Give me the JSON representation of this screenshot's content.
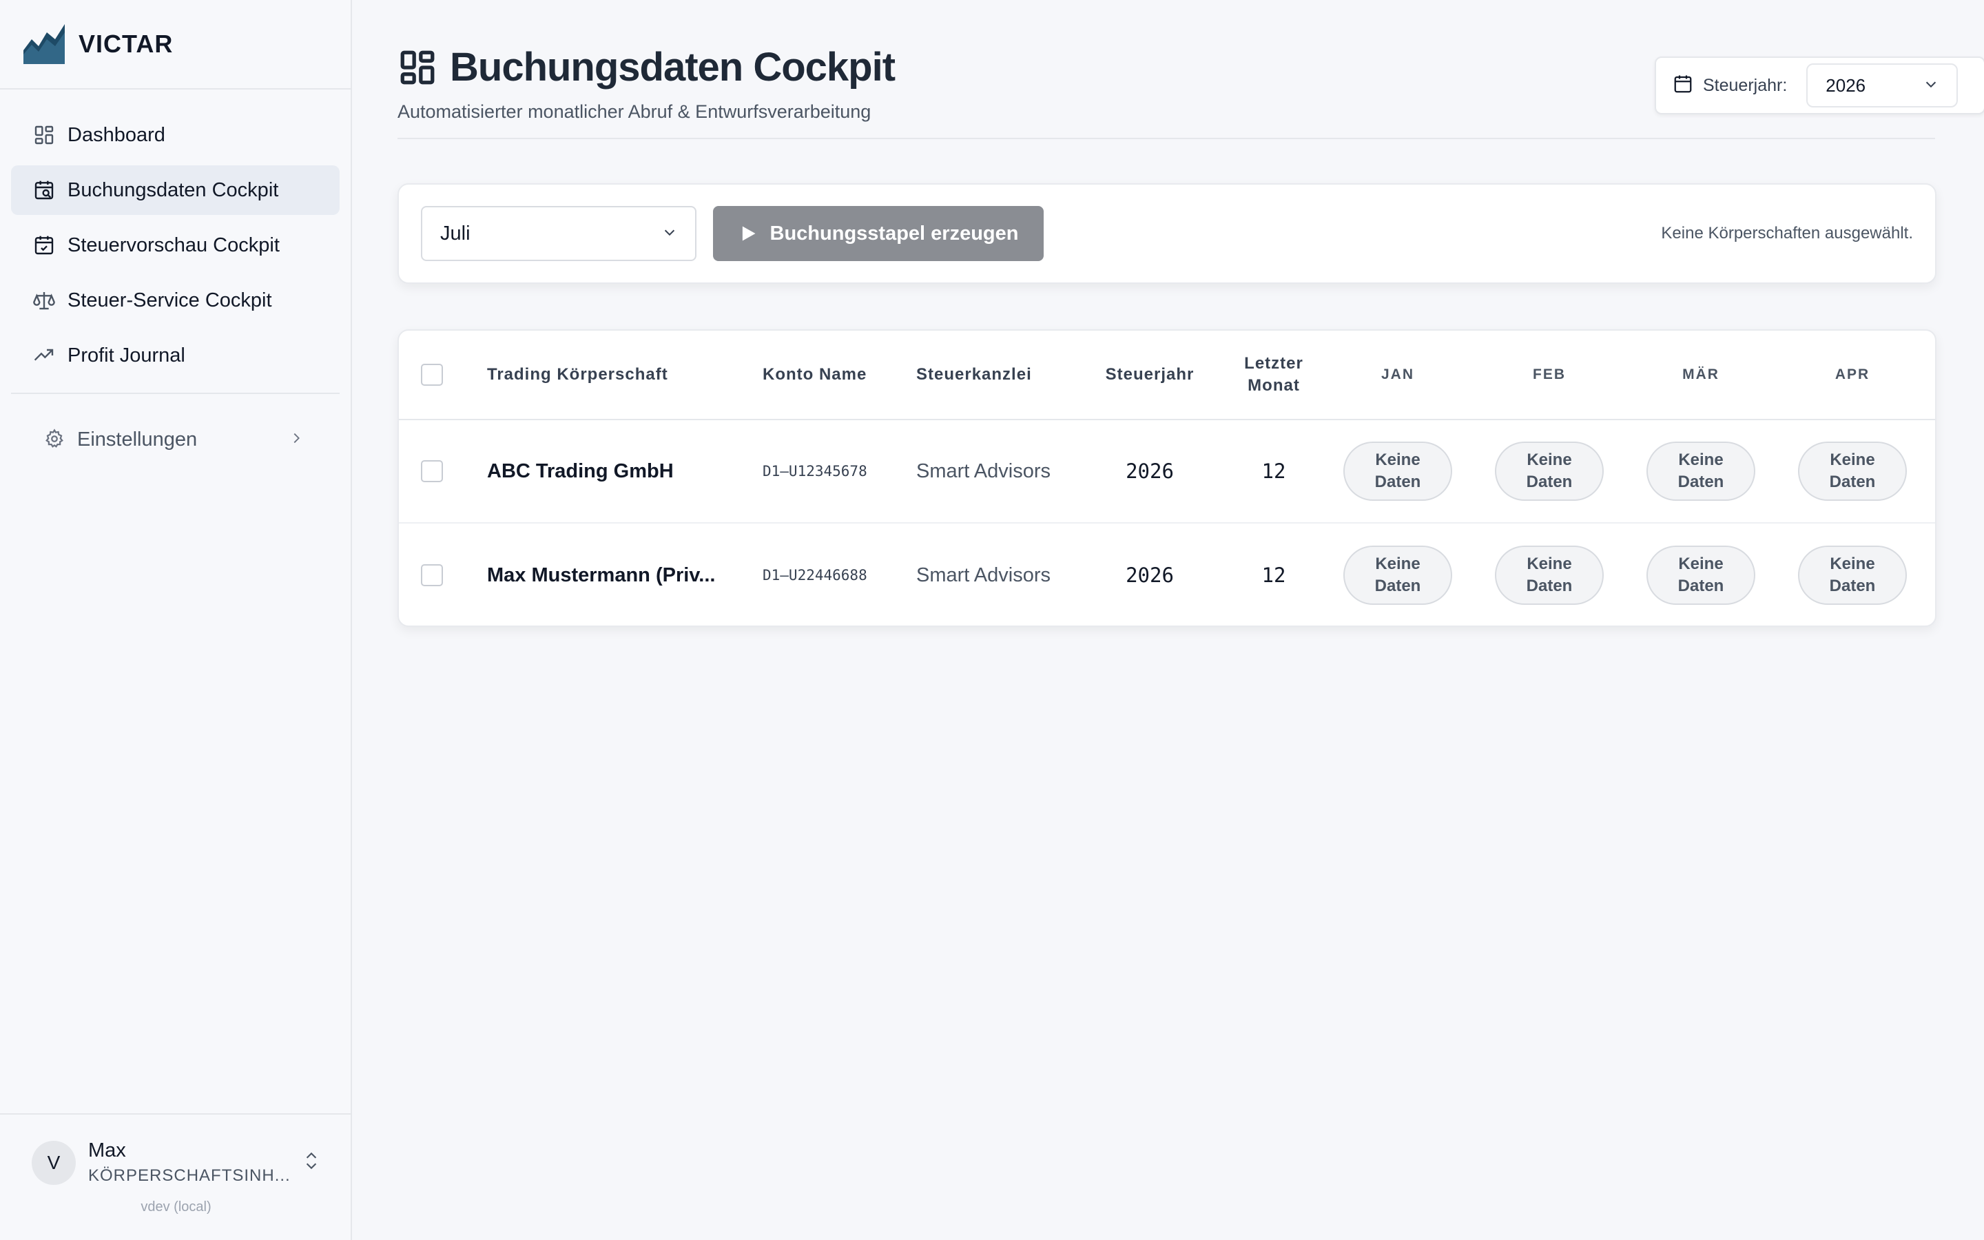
{
  "brand": {
    "name": "VICTAR"
  },
  "nav": {
    "items": [
      {
        "label": "Dashboard",
        "icon": "dashboard-icon",
        "active": false
      },
      {
        "label": "Buchungsdaten Cockpit",
        "icon": "calendar-search-icon",
        "active": true
      },
      {
        "label": "Steuervorschau Cockpit",
        "icon": "calendar-check-icon",
        "active": false
      },
      {
        "label": "Steuer-Service Cockpit",
        "icon": "scale-icon",
        "active": false
      },
      {
        "label": "Profit Journal",
        "icon": "trending-up-icon",
        "active": false
      }
    ],
    "settings_label": "Einstellungen"
  },
  "user": {
    "initial": "V",
    "name": "Max",
    "role": "KÖRPERSCHAFTSINH...",
    "version": "vdev (local)"
  },
  "header": {
    "title": "Buchungsdaten Cockpit",
    "subtitle": "Automatisierter monatlicher Abruf & Entwurfsverarbeitung",
    "year_label": "Steuerjahr:",
    "year_value": "2026"
  },
  "toolbar": {
    "month_value": "Juli",
    "generate_label": "Buchungsstapel erzeugen",
    "status": "Keine Körperschaften ausgewählt."
  },
  "table": {
    "headers": {
      "entity": "Trading Körperschaft",
      "account": "Konto Name",
      "firm": "Steuerkanzlei",
      "year": "Steuerjahr",
      "last_month_1": "Letzter",
      "last_month_2": "Monat"
    },
    "months": [
      "JAN",
      "FEB",
      "MÄR",
      "APR"
    ],
    "rows": [
      {
        "entity": "ABC Trading GmbH",
        "account": "D1–U12345678",
        "firm": "Smart Advisors",
        "year": "2026",
        "last_month": "12",
        "status": [
          "Keine Daten",
          "Keine Daten",
          "Keine Daten",
          "Keine Daten"
        ]
      },
      {
        "entity": "Max Mustermann (Priv...",
        "account": "D1–U22446688",
        "firm": "Smart Advisors",
        "year": "2026",
        "last_month": "12",
        "status": [
          "Keine Daten",
          "Keine Daten",
          "Keine Daten",
          "Keine Daten"
        ]
      }
    ]
  },
  "colors": {
    "primary_text": "#111827",
    "button_disabled": "#8a8d93",
    "active_nav": "#e8ecf3",
    "logo": "#1e4a66"
  }
}
